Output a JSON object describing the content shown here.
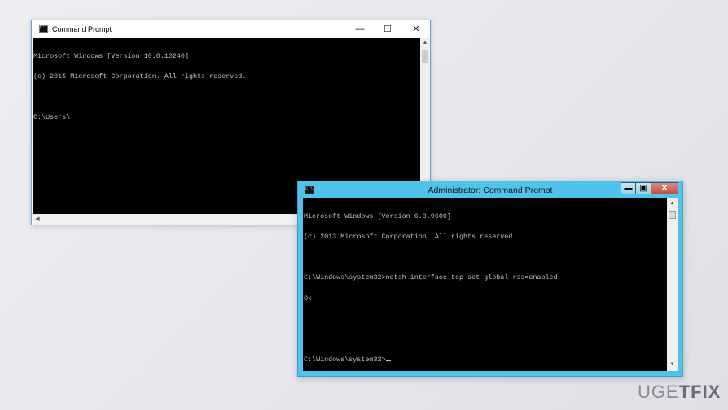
{
  "window1": {
    "title": "Command Prompt",
    "controls": {
      "minimize": "—",
      "maximize": "☐",
      "close": "✕"
    },
    "console_lines": [
      "Microsoft Windows [Version 10.0.10240]",
      "(c) 2015 Microsoft Corporation. All rights reserved.",
      "",
      "C:\\Users\\"
    ],
    "scroll_up": "▲",
    "scroll_left": "◀"
  },
  "window2": {
    "title": "Administrator: Command Prompt",
    "controls": {
      "minimize": "▬",
      "maximize": "▣",
      "close": "✕"
    },
    "console_lines": [
      "Microsoft Windows [Version 6.3.9600]",
      "(c) 2013 Microsoft Corporation. All rights reserved.",
      "",
      "C:\\Windows\\system32>netsh interface tcp set global rss=enabled",
      "Ok.",
      "",
      "",
      "C:\\Windows\\system32>"
    ],
    "scroll_up": "▲",
    "scroll_down": "▼"
  },
  "logo": {
    "text_left": "UG",
    "text_mid": "E",
    "text_right": "TFIX"
  },
  "colors": {
    "accent_admin": "#4fc3ea",
    "console_bg": "#000000",
    "console_text": "#c0c0c0"
  }
}
